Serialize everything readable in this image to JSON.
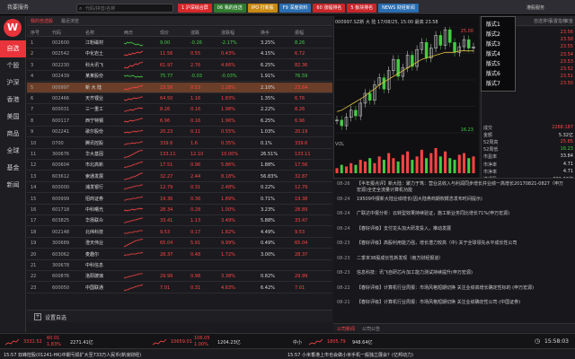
{
  "app": {
    "title": "我要服务",
    "right_title": "港股服务"
  },
  "search": {
    "placeholder": "代码/拼音/名称"
  },
  "topbar": {
    "buttons": [
      {
        "label": "1 沪深综合屏",
        "color": "#d8262a"
      },
      {
        "label": "06 我的自选",
        "color": "#2f7a2f"
      },
      {
        "label": "IPO 打新股",
        "color": "#c88a12"
      },
      {
        "label": "F9 深度资料",
        "color": "#2a6db0"
      },
      {
        "label": "60 涨幅排名",
        "color": "#c8262a"
      },
      {
        "label": "5 板块排名",
        "color": "#c8262a"
      },
      {
        "label": "NEWS 财经新闻",
        "color": "#2a6db0"
      }
    ]
  },
  "nav": {
    "items": [
      "自选",
      "个股",
      "沪深",
      "香港",
      "美国",
      "商品",
      "全球",
      "基金",
      "新闻"
    ],
    "active": 0
  },
  "tabs": {
    "items": [
      "我的自选股",
      "最近浏览"
    ],
    "active": 0
  },
  "columns": [
    "序号",
    "代码",
    "名称",
    "两日",
    "现价",
    "涨跌",
    "涨跌幅",
    "换手",
    "振幅"
  ],
  "rows": [
    {
      "no": "1",
      "code": "002600",
      "name": "江粉磁材",
      "price": "9.00",
      "chg": "-0.26",
      "pct": "-2.17%",
      "turn": "3.25%",
      "amp": "8.26",
      "dir": "dn",
      "spark": [
        5,
        4,
        6,
        5,
        6,
        5,
        4,
        3,
        4,
        3,
        2,
        3
      ]
    },
    {
      "no": "2",
      "code": "002542",
      "name": "中化岩土",
      "price": "11.56",
      "chg": "0.55",
      "pct": "0.43%",
      "turn": "4.15%",
      "amp": "6.72",
      "dir": "up",
      "spark": [
        3,
        4,
        3,
        5,
        4,
        6,
        5,
        6,
        7,
        6,
        7,
        8
      ]
    },
    {
      "no": "3",
      "code": "002230",
      "name": "科大讯飞",
      "price": "61.97",
      "chg": "2.76",
      "pct": "4.66%",
      "turn": "6.25%",
      "amp": "82.36",
      "dir": "up",
      "spark": [
        2,
        3,
        2,
        4,
        5,
        4,
        6,
        7,
        6,
        8,
        8,
        9
      ]
    },
    {
      "no": "4",
      "code": "002439",
      "name": "某某股份",
      "price": "75.77",
      "chg": "-0.03",
      "pct": "-0.03%",
      "turn": "1.91%",
      "amp": "76.59",
      "dir": "dn",
      "spark": [
        6,
        5,
        6,
        5,
        5,
        6,
        5,
        4,
        5,
        4,
        5,
        4
      ]
    },
    {
      "no": "5",
      "code": "000997",
      "name": "新 大 陆",
      "price": "23.56",
      "chg": "0.53",
      "pct": "2.28%",
      "turn": "2.10%",
      "amp": "23.64",
      "dir": "up",
      "spark": [
        3,
        4,
        3,
        4,
        5,
        5,
        6,
        5,
        6,
        7,
        7,
        8
      ]
    },
    {
      "no": "6",
      "code": "002466",
      "name": "天齐锂业",
      "price": "64.50",
      "chg": "1.16",
      "pct": "1.83%",
      "turn": "1.35%",
      "amp": "6.76",
      "dir": "up",
      "spark": [
        4,
        3,
        4,
        5,
        4,
        5,
        6,
        5,
        6,
        6,
        7,
        7
      ]
    },
    {
      "no": "7",
      "code": "600031",
      "name": "三一重工",
      "price": "8.26",
      "chg": "0.16",
      "pct": "1.98%",
      "turn": "2.22%",
      "amp": "8.26",
      "dir": "up",
      "spark": [
        3,
        3,
        4,
        4,
        5,
        4,
        5,
        6,
        6,
        7,
        6,
        7
      ]
    },
    {
      "no": "8",
      "code": "600117",
      "name": "西宁特钢",
      "price": "6.96",
      "chg": "0.16",
      "pct": "1.96%",
      "turn": "6.25%",
      "amp": "6.96",
      "dir": "up",
      "spark": [
        4,
        5,
        4,
        5,
        6,
        5,
        6,
        6,
        7,
        7,
        8,
        8
      ]
    },
    {
      "no": "9",
      "code": "002241",
      "name": "歌尔股份",
      "price": "20.23",
      "chg": "0.11",
      "pct": "0.55%",
      "turn": "1.03%",
      "amp": "20.19",
      "dir": "up",
      "spark": [
        5,
        4,
        5,
        4,
        5,
        5,
        6,
        5,
        6,
        6,
        6,
        7
      ]
    },
    {
      "no": "10",
      "code": "0700",
      "name": "腾讯控股",
      "price": "339.6",
      "chg": "1.6",
      "pct": "0.35%",
      "turn": "0.1%",
      "amp": "339.6",
      "dir": "up",
      "spark": [
        4,
        4,
        5,
        5,
        5,
        6,
        5,
        6,
        6,
        6,
        7,
        7
      ]
    },
    {
      "no": "11",
      "code": "300676",
      "name": "华大基因",
      "price": "133.11",
      "chg": "12.10",
      "pct": "10.00%",
      "turn": "26.51%",
      "amp": "133.11",
      "dir": "up",
      "spark": [
        1,
        2,
        2,
        3,
        4,
        5,
        6,
        7,
        8,
        9,
        9,
        10
      ]
    },
    {
      "no": "12",
      "code": "600604",
      "name": "市北高新",
      "price": "17.51",
      "chg": "0.96",
      "pct": "5.86%",
      "turn": "1.88%",
      "amp": "17.56",
      "dir": "up",
      "spark": [
        2,
        3,
        3,
        4,
        4,
        5,
        6,
        6,
        7,
        8,
        8,
        9
      ]
    },
    {
      "no": "13",
      "code": "603612",
      "name": "索通发展",
      "price": "32.27",
      "chg": "2.44",
      "pct": "8.18%",
      "turn": "56.83%",
      "amp": "32.87",
      "dir": "up",
      "spark": [
        2,
        2,
        3,
        3,
        4,
        5,
        5,
        6,
        7,
        8,
        9,
        9
      ]
    },
    {
      "no": "14",
      "code": "600000",
      "name": "浦发银行",
      "price": "12.79",
      "chg": "0.31",
      "pct": "2.48%",
      "turn": "0.22%",
      "amp": "12.79",
      "dir": "up",
      "spark": [
        3,
        4,
        4,
        5,
        5,
        6,
        6,
        7,
        7,
        7,
        8,
        8
      ]
    },
    {
      "no": "15",
      "code": "600999",
      "name": "招商证券",
      "price": "19.36",
      "chg": "0.36",
      "pct": "1.89%",
      "turn": "0.71%",
      "amp": "19.38",
      "dir": "up",
      "spark": [
        4,
        4,
        5,
        5,
        5,
        6,
        6,
        6,
        7,
        7,
        7,
        8
      ]
    },
    {
      "no": "16",
      "code": "601718",
      "name": "中科曙光",
      "price": "28.34",
      "chg": "0.28",
      "pct": "1.00%",
      "turn": "3.23%",
      "amp": "28.89",
      "dir": "up",
      "spark": [
        4,
        5,
        4,
        5,
        5,
        6,
        5,
        6,
        6,
        7,
        6,
        7
      ]
    },
    {
      "no": "17",
      "code": "603825",
      "name": "华扬联众",
      "price": "33.41",
      "chg": "1.13",
      "pct": "3.49%",
      "turn": "5.88%",
      "amp": "33.47",
      "dir": "up",
      "spark": [
        3,
        3,
        4,
        4,
        5,
        5,
        6,
        6,
        7,
        7,
        8,
        8
      ]
    },
    {
      "no": "18",
      "code": "002148",
      "name": "北纬科技",
      "price": "9.53",
      "chg": "0.17",
      "pct": "1.82%",
      "turn": "4.49%",
      "amp": "9.53",
      "dir": "up",
      "spark": [
        4,
        4,
        4,
        5,
        5,
        5,
        6,
        6,
        6,
        7,
        7,
        7
      ]
    },
    {
      "no": "19",
      "code": "300689",
      "name": "澄天伟业",
      "price": "65.04",
      "chg": "5.91",
      "pct": "9.99%",
      "turn": "0.49%",
      "amp": "65.04",
      "dir": "up",
      "spark": [
        1,
        2,
        3,
        4,
        5,
        6,
        7,
        8,
        8,
        9,
        9,
        10
      ]
    },
    {
      "no": "20",
      "code": "603062",
      "name": "麦趣尔",
      "price": "28.37",
      "chg": "0.48",
      "pct": "1.72%",
      "turn": "3.00%",
      "amp": "28.37",
      "dir": "up",
      "spark": [
        4,
        5,
        5,
        5,
        6,
        6,
        6,
        6,
        7,
        7,
        7,
        8
      ]
    },
    {
      "no": "21",
      "code": "300678",
      "name": "中科信息",
      "price": "",
      "chg": "",
      "pct": "",
      "turn": "",
      "amp": "",
      "dir": "gr",
      "spark": []
    },
    {
      "no": "22",
      "code": "600876",
      "name": "洛阳玻璃",
      "price": "29.99",
      "chg": "0.98",
      "pct": "3.38%",
      "turn": "0.82%",
      "amp": "29.99",
      "dir": "up",
      "spark": [
        3,
        4,
        4,
        5,
        5,
        6,
        6,
        7,
        7,
        8,
        8,
        8
      ]
    },
    {
      "no": "23",
      "code": "600050",
      "name": "中国联通",
      "price": "7.01",
      "chg": "0.31",
      "pct": "4.63%",
      "turn": "6.42%",
      "amp": "7.01",
      "dir": "up",
      "spark": [
        2,
        3,
        3,
        4,
        5,
        5,
        6,
        7,
        7,
        8,
        8,
        9
      ]
    }
  ],
  "settings": {
    "label": "设置自选"
  },
  "chart": {
    "header": "000997.SZ新 大 陆 17/08/25, 15:00 最高 23.58",
    "price_top": "25.00",
    "price_bottom": "16.23",
    "vol_label": "VOL",
    "prices": [
      18.4,
      18.0,
      18.6,
      19.1,
      18.7,
      19.6,
      20.3,
      19.8,
      20.9,
      21.4,
      20.6,
      21.9,
      22.7,
      21.5,
      22.1,
      23.0,
      22.2,
      23.4,
      23.9,
      22.8,
      23.5,
      24.4,
      23.7,
      24.8,
      23.9,
      23.2,
      23.6,
      24.1,
      23.5,
      23.58
    ],
    "ma": [
      19.0,
      19.1,
      19.3,
      19.5,
      19.7,
      19.9,
      20.1,
      20.4,
      20.6,
      20.9,
      21.1,
      21.3,
      21.5,
      21.7,
      21.9,
      22.1,
      22.3,
      22.5,
      22.7,
      22.8,
      22.9,
      23.0,
      23.1,
      23.2,
      23.2,
      23.2,
      23.3,
      23.3,
      23.3,
      23.3
    ],
    "volumes": [
      3,
      5,
      4,
      6,
      5,
      8,
      7,
      9,
      6,
      10,
      8,
      12,
      9,
      7,
      11,
      13,
      8,
      10,
      14,
      9,
      12,
      15,
      10,
      13,
      9,
      8,
      11,
      12,
      9,
      10
    ]
  },
  "dropdown": {
    "items": [
      "版式1",
      "版式2",
      "版式3",
      "版式4",
      "版式5",
      "版式6",
      "版式7"
    ]
  },
  "rp_tabs": [
    "版式1",
    "自选排行",
    "设置指标",
    "资金"
  ],
  "right_panel": {
    "rows": [
      {
        "label": "",
        "value": "23.56",
        "color": "#f44"
      },
      {
        "label": "",
        "value": "23.58",
        "color": "#f44"
      },
      {
        "label": "",
        "value": "23.55",
        "color": "#f44"
      },
      {
        "label": "",
        "value": "23.54",
        "color": "#f44"
      },
      {
        "label": "",
        "value": "23.53",
        "color": "#f44"
      },
      {
        "label": "",
        "value": "23.52",
        "color": "#f44"
      },
      {
        "label": "",
        "value": "23.51",
        "color": "#f44"
      },
      {
        "label": "",
        "value": "23.50",
        "color": "#f44"
      },
      {
        "label": "成交",
        "value": "2268.187",
        "color": "#f44"
      },
      {
        "label": "金额",
        "value": "5.32亿",
        "color": "#ddd"
      },
      {
        "label": "52周高",
        "value": "25.85",
        "color": "#f44"
      },
      {
        "label": "52周低",
        "value": "16.23",
        "color": "#4c4"
      },
      {
        "label": "市盈率",
        "value": "33.84",
        "color": "#ddd"
      },
      {
        "label": "市净率",
        "value": "4.71",
        "color": "#ddd"
      },
      {
        "label": "市净率",
        "value": "4.71",
        "color": "#ddd"
      },
      {
        "label": "流通股",
        "value": "221.22亿",
        "color": "#ddd"
      }
    ]
  },
  "news": {
    "items": [
      {
        "date": "08-26",
        "text": "【半年报点评】新大陆：聚力于笃：营业总收入与利润同步增长并业绩一高增长20170821-0827（申万宏源)全史全流量计算机功能"
      },
      {
        "date": "08-24",
        "text": "19509中报新大陆业绩增长(因大陆券商期权概念发布时间提示)"
      },
      {
        "date": "08-24",
        "text": "广联达中报分析：云转型效果持续验证，施工新业务同比增长71%(申万宏源)"
      },
      {
        "date": "08-24",
        "text": "【春好评级】支付龙头加大研发投入，推动发展"
      },
      {
        "date": "08-23",
        "text": "【春好评级】高股利用能力强，增长潜力较高（中) 关于全球领先水平成长性公司"
      },
      {
        "date": "08-23",
        "text": "二季末38股成长性新发现（南方财经报道）"
      },
      {
        "date": "08-23",
        "text": "信息科技：讯飞自研芯片加工能力测试持续提升(申万宏源)"
      },
      {
        "date": "08-22",
        "text": "【春好评级】计算机行业周报：市场风格短期切换 关注业绩高增长确定性标的 (申万宏源)"
      },
      {
        "date": "08-21",
        "text": "【春好评级】计算机行业周报：市场风格短期切换 关注业绩确定性公司 (中国证券)"
      }
    ],
    "footer": [
      "公司新闻",
      "公司公告"
    ]
  },
  "ticker": [
    {
      "price": "3331.52",
      "chg": "60.01",
      "pct": "1.83%",
      "vol": "2271.41亿",
      "dir": "up"
    },
    {
      "price": "10659.01",
      "chg": "106.05",
      "pct": "1.00%",
      "vol": "1204.23亿",
      "dir": "up"
    },
    {
      "price": "1805.79",
      "chg": "",
      "pct": "",
      "vol": "948.64亿",
      "dir": "up",
      "name": "中小"
    }
  ],
  "time": "15:58:03",
  "bottom_news": [
    "15:57 双峰控股(01241-HK)中期亏损扩大至733万人民币(新浪财经)",
    "15:57 小米香港上市也会做小米手机一般独立展会？(亿邦动力)"
  ]
}
